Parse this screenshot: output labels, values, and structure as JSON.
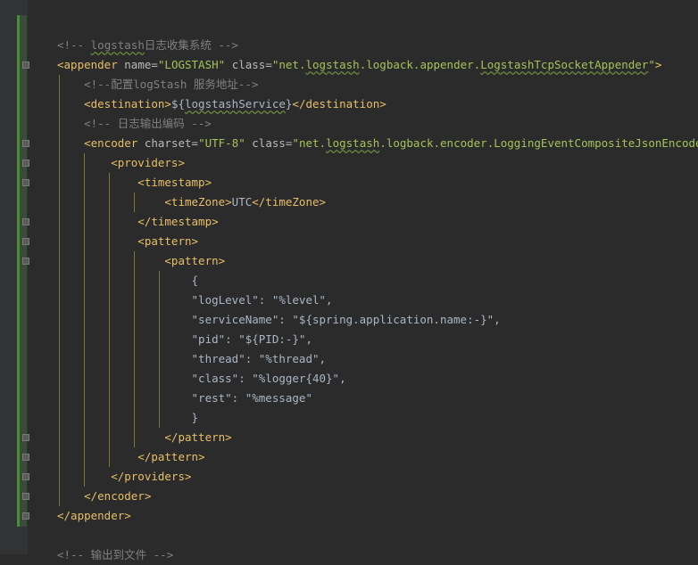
{
  "lines": [
    [
      {
        "c": "comment",
        "t": "<!-- "
      },
      {
        "c": "comment under",
        "t": "logstash"
      },
      {
        "c": "comment",
        "t": "日志收集系统 -->"
      }
    ],
    [
      {
        "c": "tag",
        "t": "<appender "
      },
      {
        "c": "attr",
        "t": "name"
      },
      {
        "c": "text",
        "t": "="
      },
      {
        "c": "val",
        "t": "\"LOGSTASH\""
      },
      {
        "c": "attr",
        "t": " class"
      },
      {
        "c": "text",
        "t": "="
      },
      {
        "c": "val",
        "t": "\"net."
      },
      {
        "c": "val under",
        "t": "logstash"
      },
      {
        "c": "val",
        "t": ".logback.appender."
      },
      {
        "c": "val under",
        "t": "LogstashTcpSocketAppender"
      },
      {
        "c": "val",
        "t": "\""
      },
      {
        "c": "tag",
        "t": ">"
      }
    ],
    [
      {
        "c": "comment",
        "t": "    <!--配置logStash 服务地址-->"
      }
    ],
    [
      {
        "c": "tag",
        "t": "    <destination>"
      },
      {
        "c": "text",
        "t": "${"
      },
      {
        "c": "text under",
        "t": "logstashService"
      },
      {
        "c": "text",
        "t": "}"
      },
      {
        "c": "tag",
        "t": "</destination>"
      }
    ],
    [
      {
        "c": "comment",
        "t": "    <!-- 日志输出编码 -->"
      }
    ],
    [
      {
        "c": "tag",
        "t": "    <encoder "
      },
      {
        "c": "attr",
        "t": "charset"
      },
      {
        "c": "text",
        "t": "="
      },
      {
        "c": "val",
        "t": "\"UTF-8\""
      },
      {
        "c": "attr",
        "t": " class"
      },
      {
        "c": "text",
        "t": "="
      },
      {
        "c": "val",
        "t": "\"net."
      },
      {
        "c": "val under",
        "t": "logstash"
      },
      {
        "c": "val",
        "t": ".logback.encoder.LoggingEventCompositeJsonEncoder\""
      },
      {
        "c": "tag",
        "t": ">"
      }
    ],
    [
      {
        "c": "tag",
        "t": "        <providers>"
      }
    ],
    [
      {
        "c": "tag",
        "t": "            <timestamp>"
      }
    ],
    [
      {
        "c": "tag",
        "t": "                <timeZone>"
      },
      {
        "c": "text",
        "t": "UTC"
      },
      {
        "c": "tag",
        "t": "</timeZone>"
      }
    ],
    [
      {
        "c": "tag",
        "t": "            </timestamp>"
      }
    ],
    [
      {
        "c": "tag",
        "t": "            <pattern>"
      }
    ],
    [
      {
        "c": "tag",
        "t": "                <pattern>"
      }
    ],
    [
      {
        "c": "text",
        "t": "                    {"
      }
    ],
    [
      {
        "c": "text",
        "t": "                    \"logLevel\": \"%level\","
      }
    ],
    [
      {
        "c": "text",
        "t": "                    \"serviceName\": \"${spring.application.name:-}\","
      }
    ],
    [
      {
        "c": "text",
        "t": "                    \"pid\": \"${PID:-}\","
      }
    ],
    [
      {
        "c": "text",
        "t": "                    \"thread\": \"%thread\","
      }
    ],
    [
      {
        "c": "text",
        "t": "                    \"class\": \"%logger{40}\","
      }
    ],
    [
      {
        "c": "text",
        "t": "                    \"rest\": \"%message\""
      }
    ],
    [
      {
        "c": "text",
        "t": "                    }"
      }
    ],
    [
      {
        "c": "tag",
        "t": "                </pattern>"
      }
    ],
    [
      {
        "c": "tag",
        "t": "            </pattern>"
      }
    ],
    [
      {
        "c": "tag",
        "t": "        </providers>"
      }
    ],
    [
      {
        "c": "tag",
        "t": "    </encoder>"
      }
    ],
    [
      {
        "c": "tag",
        "t": "</appender>"
      }
    ],
    [
      {
        "c": "text",
        "t": ""
      }
    ],
    [
      {
        "c": "comment",
        "t": "<!-- 输出到文件 -->"
      }
    ]
  ]
}
